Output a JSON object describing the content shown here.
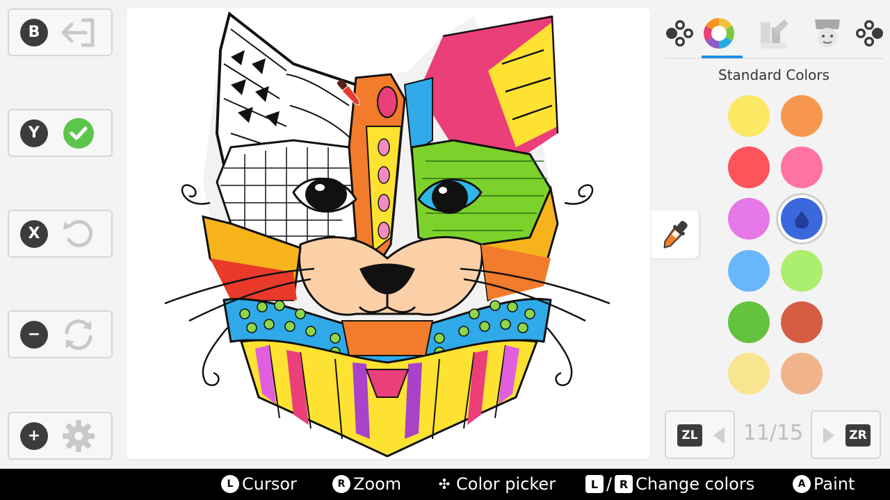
{
  "left_buttons": [
    {
      "glyph": "B",
      "icon": "exit-icon"
    },
    {
      "glyph": "Y",
      "icon": "check-icon"
    },
    {
      "glyph": "X",
      "icon": "undo-icon"
    },
    {
      "glyph": "−",
      "icon": "reset-icon"
    },
    {
      "glyph": "+",
      "icon": "gear-icon"
    }
  ],
  "tabs": [
    {
      "icon": "stamp-icon"
    },
    {
      "icon": "color-wheel-icon",
      "active": true
    },
    {
      "icon": "pattern-icon"
    },
    {
      "icon": "character-icon"
    }
  ],
  "palette": {
    "title": "Standard Colors",
    "swatches": [
      {
        "color": "#fde863"
      },
      {
        "color": "#f7974e"
      },
      {
        "color": "#fb5459"
      },
      {
        "color": "#fd73a3"
      },
      {
        "color": "#e579e8"
      },
      {
        "color": "#3b68dc",
        "selected": true
      },
      {
        "color": "#68b6fb"
      },
      {
        "color": "#acee6d"
      },
      {
        "color": "#63c33e"
      },
      {
        "color": "#d65d44"
      },
      {
        "color": "#f7e68f"
      },
      {
        "color": "#f1b38a"
      }
    ]
  },
  "pager": {
    "left_key": "ZL",
    "right_key": "ZR",
    "page": "11/15"
  },
  "hints": [
    {
      "glyph": "L",
      "label": "Cursor"
    },
    {
      "glyph": "R",
      "label": "Zoom"
    },
    {
      "glyph": "✣",
      "label": "Color picker"
    },
    {
      "key_left": "L",
      "sep": "/",
      "key_right": "R",
      "label": "Change colors"
    },
    {
      "glyph": "A",
      "label": "Paint"
    }
  ],
  "colors": {
    "accent": "#1a90e8",
    "check": "#5cc64c"
  }
}
